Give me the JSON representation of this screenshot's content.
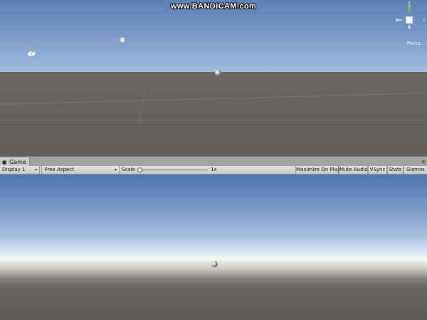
{
  "watermark": {
    "text": "www.BANDICAM.com"
  },
  "scene_view": {
    "gizmo": {
      "axis_y": "y",
      "axis_z": "z",
      "projection_label": "Persp",
      "colors": {
        "y_axis": "#6bd24a",
        "z_axis": "#4d8ff0",
        "x_axis": "#d9d9d9"
      }
    },
    "icons": [
      "sun-icon",
      "camera-icon",
      "sphere"
    ]
  },
  "game_panel": {
    "tab_label": "Game",
    "tab_menu_glyph": "≡",
    "toolbar": {
      "display_select": "Display 1",
      "aspect_select": "Free Aspect",
      "scale_label": "Scale",
      "scale_value": "1x",
      "scale_slider_fraction": 0.02,
      "buttons": {
        "maximize_on_play": "Maximize On Play",
        "mute_audio": "Mute Audio",
        "vsync": "VSync",
        "stats": "Stats",
        "gizmos": "Gizmos"
      },
      "dropdown_glyph": "▾"
    }
  }
}
